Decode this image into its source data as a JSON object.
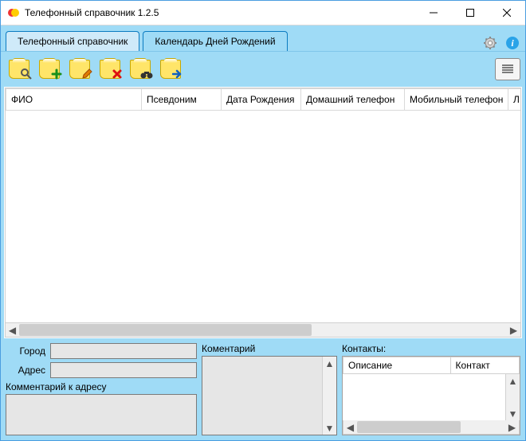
{
  "window": {
    "title": "Телефонный справочник 1.2.5"
  },
  "tabs": {
    "directory": "Телефонный справочник",
    "birthdays": "Календарь Дней Рождений"
  },
  "grid": {
    "columns": {
      "fio": "ФИО",
      "alias": "Псевдоним",
      "birthdate": "Дата Рождения",
      "homephone": "Домашний телефон",
      "mobile": "Мобильный телефон",
      "extra": "Л"
    }
  },
  "form": {
    "city_label": "Город",
    "city_value": "",
    "address_label": "Адрес",
    "address_value": "",
    "addr_comment_label": "Комментарий к адресу",
    "addr_comment_value": "",
    "comment_label": "Коментарий",
    "comment_value": "",
    "contacts_label": "Контакты:",
    "contacts_columns": {
      "desc": "Описание",
      "contact": "Контакт"
    }
  }
}
